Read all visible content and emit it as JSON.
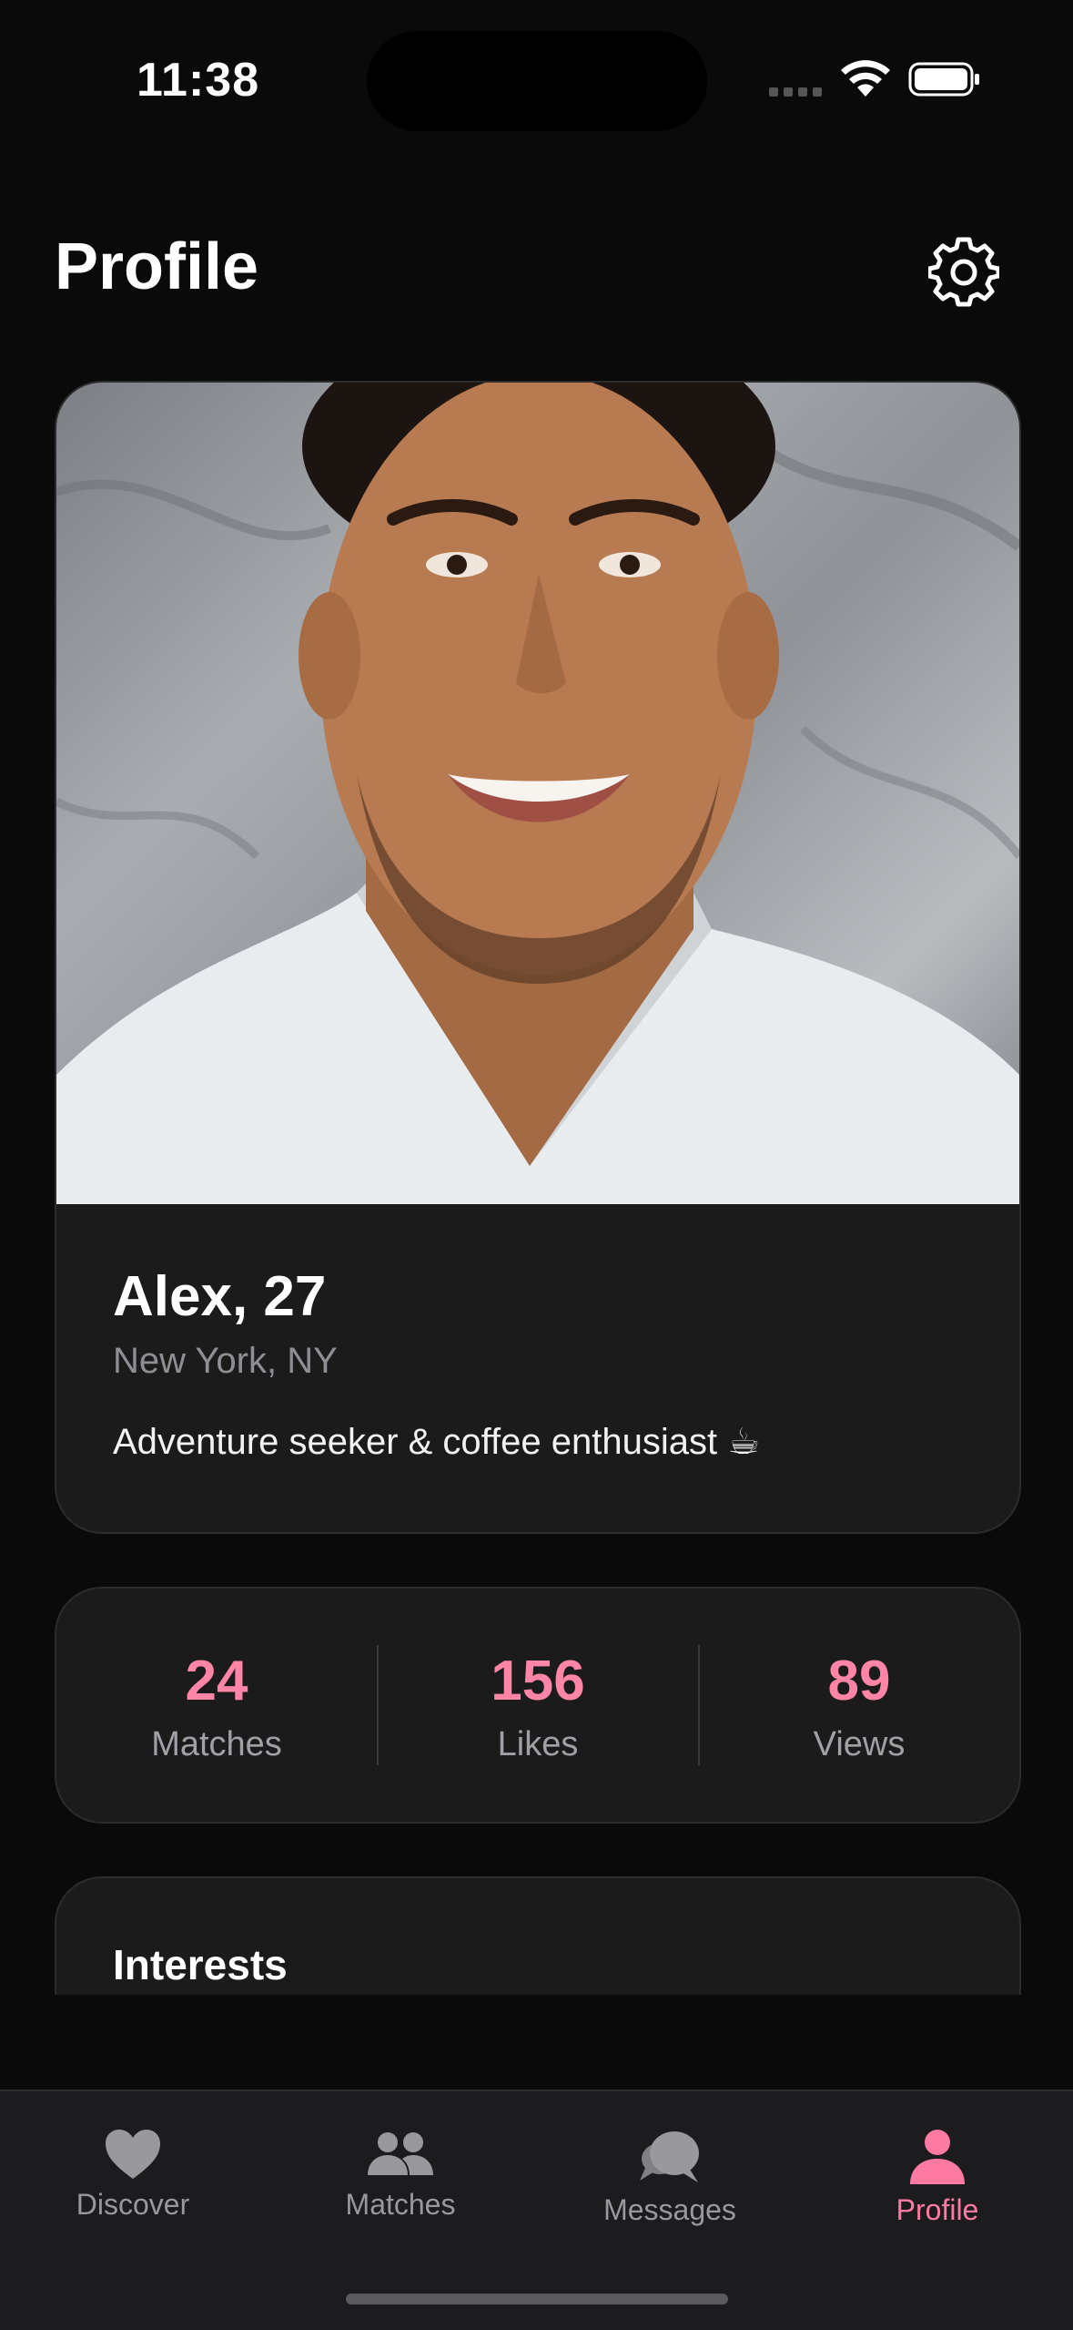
{
  "status_bar": {
    "time": "11:38"
  },
  "header": {
    "title": "Profile"
  },
  "profile": {
    "name_age": "Alex, 27",
    "location": "New York, NY",
    "bio": "Adventure seeker & coffee enthusiast ☕"
  },
  "stats": [
    {
      "value": "24",
      "label": "Matches"
    },
    {
      "value": "156",
      "label": "Likes"
    },
    {
      "value": "89",
      "label": "Views"
    }
  ],
  "interests": {
    "title": "Interests"
  },
  "tabbar": {
    "tabs": [
      {
        "label": "Discover",
        "icon": "heart-icon",
        "active": false
      },
      {
        "label": "Matches",
        "icon": "people-icon",
        "active": false
      },
      {
        "label": "Messages",
        "icon": "chat-bubbles-icon",
        "active": false
      },
      {
        "label": "Profile",
        "icon": "person-icon",
        "active": true
      }
    ]
  },
  "colors": {
    "accent": "#ff7aa2",
    "stat_value": "#ff85a6",
    "background": "#0a0a0a",
    "card": "#1b1b1b",
    "muted_text": "#8e8e93"
  }
}
